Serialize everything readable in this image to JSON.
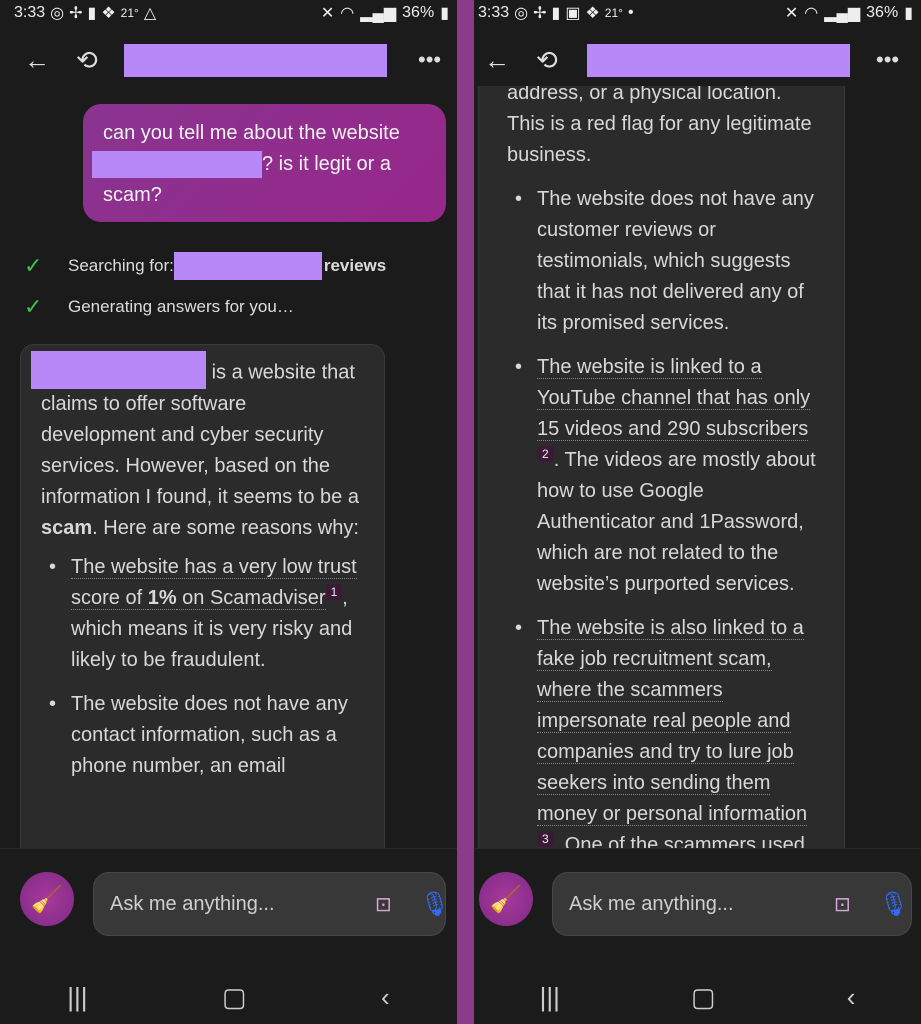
{
  "status": {
    "time": "3:33",
    "temp": "21°",
    "battery": "36%"
  },
  "left": {
    "user_message": {
      "before": "can you tell me about the website",
      "after": "? is it legit or a scam?"
    },
    "steps": [
      {
        "text": "Searching for:",
        "bold": "reviews"
      },
      {
        "text": "Generating answers for you…"
      }
    ],
    "answer": {
      "intro": "is a website that claims to offer software development and cyber security services. However, based on the information I found, it seems to be a ",
      "intro_bold": "scam",
      "intro_end": ". Here are some reasons why:",
      "b1_link1": "The website has a very low trust score of ",
      "b1_bold": "1%",
      "b1_link2": " on Scamadviser",
      "b1_cite": "1",
      "b1_rest": ", which means it is very risky and likely to be fraudulent.",
      "b2": "The website does not have any contact information, such as a phone number, an email"
    }
  },
  "right": {
    "cont": "address, or a physical location. This is a red flag for any legitimate business.",
    "b3": "The website does not have any customer reviews or testimonials, which suggests that it has not delivered any of its promised services.",
    "b4_link": "The website is linked to a YouTube channel that has only 15 videos and 290 subscribers",
    "b4_cite": "2",
    "b4_rest": ". The videos are mostly about how to use Google Authenticator and 1Password, which are not related to the website’s purported services.",
    "b5_link": "The website is also linked to a fake job recruitment scam, where the scammers impersonate real people and companies and try to lure job seekers into sending them money or personal information",
    "b5_cite": "3",
    "b5_rest": ". One of the scammers used"
  },
  "input": {
    "placeholder": "Ask me anything..."
  },
  "colors": {
    "divider": "#8c3a8a",
    "redaction": "#b888f8",
    "accent": "#96278a",
    "mic": "#2f6bff"
  }
}
